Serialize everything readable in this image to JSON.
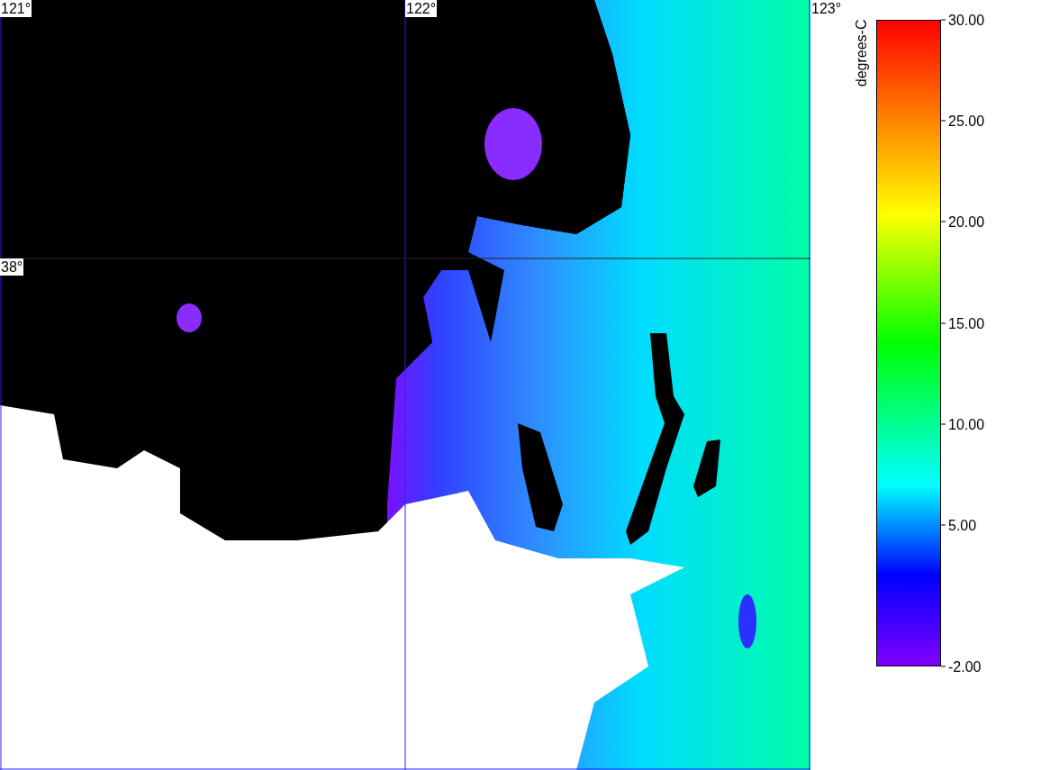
{
  "map": {
    "grid_labels": [
      {
        "kind": "longitude",
        "text": "121°"
      },
      {
        "kind": "longitude",
        "text": "122°"
      },
      {
        "kind": "longitude",
        "text": "123°"
      },
      {
        "kind": "latitude",
        "text": "38°"
      }
    ]
  },
  "colorbar": {
    "title": "degrees-C",
    "ticks": [
      "30.00",
      "25.00",
      "20.00",
      "15.00",
      "10.00",
      "5.00",
      "-2.00"
    ]
  }
}
